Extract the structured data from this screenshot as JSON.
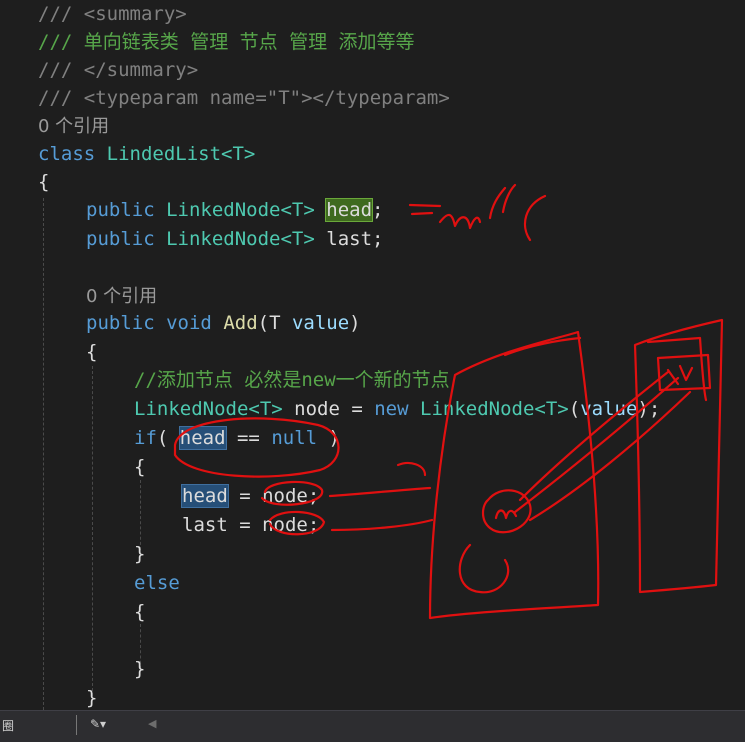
{
  "editor": {
    "codelens_refs": [
      "0 个引用",
      "0 个引用"
    ],
    "lines": {
      "l1": "/// <summary>",
      "l2": "/// 单向链表类 管理 节点 管理 添加等等",
      "l3": "/// </summary>",
      "l4": "/// <typeparam name=\"T\"></typeparam>",
      "l6_kw": "class",
      "l6_name": "LindedList<T>",
      "l7": "{",
      "l8_kw": "public",
      "l8_type": "LinkedNode<T>",
      "l8_field": "head",
      "l8_end": ";",
      "l9_kw": "public",
      "l9_type": "LinkedNode<T>",
      "l9_rest": "last;",
      "l11_kw1": "public",
      "l11_kw2": "void",
      "l11_method": "Add",
      "l11_open": "(T ",
      "l11_param": "value",
      "l11_close": ")",
      "l12": "{",
      "l13": "//添加节点 必然是new一个新的节点",
      "l14_type": "LinkedNode<T>",
      "l14_var": " node = ",
      "l14_new": "new",
      "l14_type2": "LinkedNode<T>",
      "l14_open": "(",
      "l14_param": "value",
      "l14_close": ");",
      "l15_kw": "if",
      "l15_open": "( ",
      "l15_head": "head",
      "l15_op": " == ",
      "l15_null": "null",
      "l15_close": " )",
      "l16": "{",
      "l17_head": "head",
      "l17_rest": " = node;",
      "l18": "last = node;",
      "l19": "}",
      "l20": "else",
      "l21": "{",
      "l22": "}",
      "l23": "}"
    }
  },
  "status_bar": {
    "left_label": "圈",
    "tool_glyph": "✎▾",
    "scroll_glyph": "◀"
  },
  "colors": {
    "background": "#1e1e1e",
    "annotation_red": "#e01010",
    "comment": "#57a64a",
    "keyword": "#569cd6",
    "type": "#4ec9b0"
  }
}
